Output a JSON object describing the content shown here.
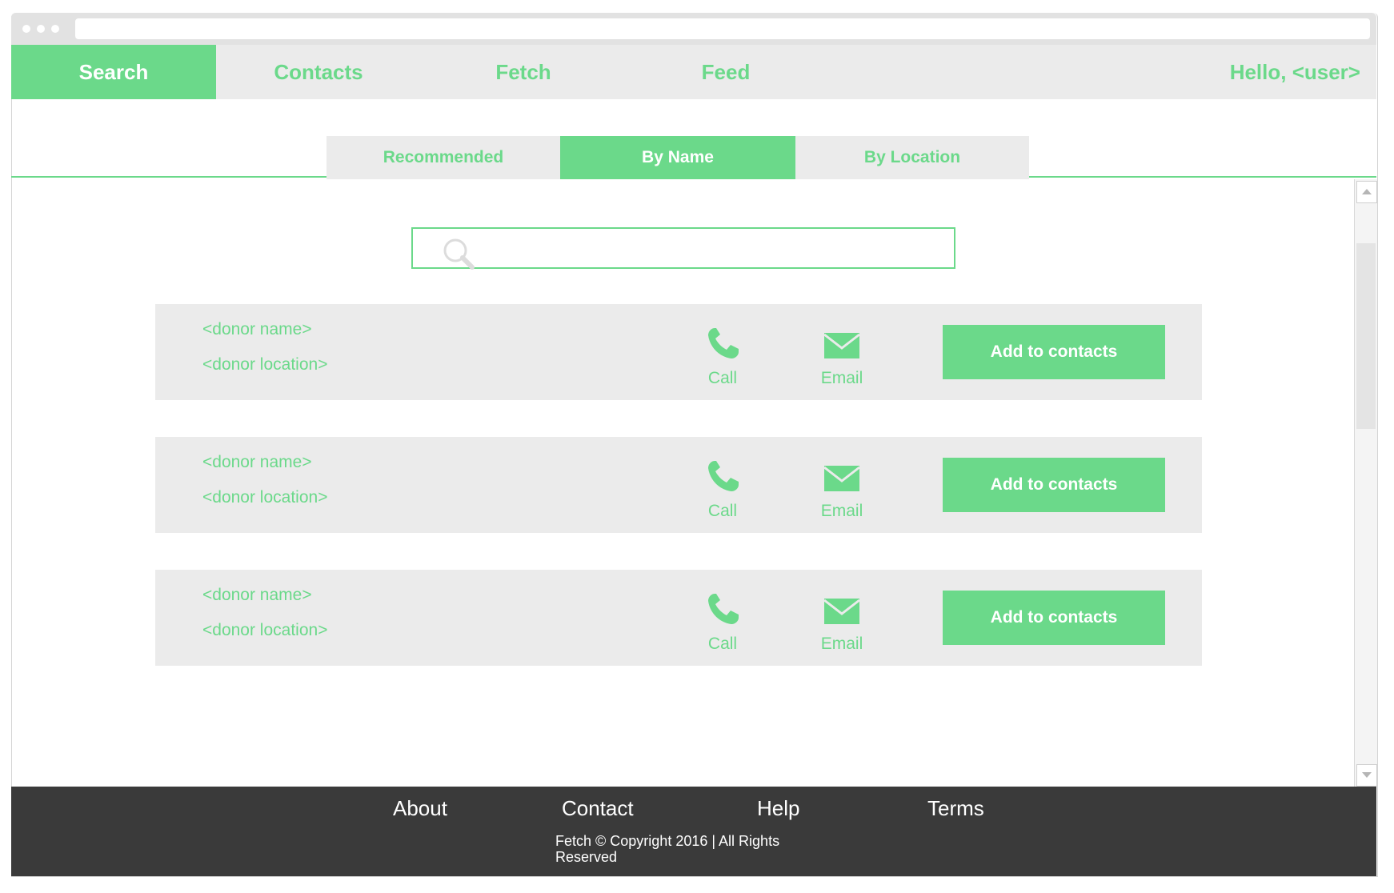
{
  "nav": {
    "items": [
      {
        "label": "Search",
        "active": true
      },
      {
        "label": "Contacts",
        "active": false
      },
      {
        "label": "Fetch",
        "active": false
      },
      {
        "label": "Feed",
        "active": false
      }
    ],
    "greeting": "Hello, <user>"
  },
  "tabs": [
    {
      "label": "Recommended",
      "active": false
    },
    {
      "label": "By Name",
      "active": true
    },
    {
      "label": "By Location",
      "active": false
    }
  ],
  "search": {
    "placeholder": "",
    "value": "",
    "icon": "search-icon"
  },
  "donors": [
    {
      "name": "<donor name>",
      "location": "<donor location>",
      "call_label": "Call",
      "email_label": "Email",
      "add_label": "Add to contacts"
    },
    {
      "name": "<donor name>",
      "location": "<donor location>",
      "call_label": "Call",
      "email_label": "Email",
      "add_label": "Add to contacts"
    },
    {
      "name": "<donor name>",
      "location": "<donor location>",
      "call_label": "Call",
      "email_label": "Email",
      "add_label": "Add to contacts"
    }
  ],
  "footer": {
    "links": [
      "About",
      "Contact",
      "Help",
      "Terms"
    ],
    "copyright": "Fetch © Copyright 2016 | All Rights Reserved"
  },
  "colors": {
    "accent": "#6bd98a",
    "panel": "#ebebeb",
    "footer": "#3a3a3a"
  }
}
